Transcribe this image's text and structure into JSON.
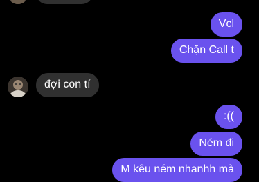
{
  "app": {
    "accent_color": "#6a52ee",
    "incoming_bubble_color": "#303030",
    "background_color": "#000000"
  },
  "conversation": {
    "messages": [
      {
        "id": "m0",
        "direction": "incoming",
        "text": ""
      },
      {
        "id": "m1",
        "direction": "outgoing",
        "text": "Vcl"
      },
      {
        "id": "m2",
        "direction": "outgoing",
        "text": "Chặn Call t"
      },
      {
        "id": "m3",
        "direction": "incoming",
        "text": "đợi con tí"
      },
      {
        "id": "m4",
        "direction": "outgoing",
        "text": ":(("
      },
      {
        "id": "m5",
        "direction": "outgoing",
        "text": "Ném đi"
      },
      {
        "id": "m6",
        "direction": "outgoing",
        "text": "M kêu ném nhanhh mà"
      }
    ]
  }
}
